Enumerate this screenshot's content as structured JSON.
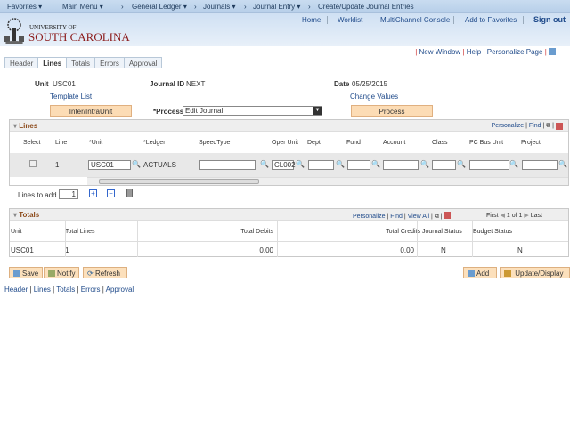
{
  "nav": {
    "favorites": "Favorites ▾",
    "main_menu": "Main Menu ▾",
    "bc1": "General Ledger ▾",
    "bc2": "Journals ▾",
    "bc3": "Journal Entry ▾",
    "bc4": "Create/Update Journal Entries"
  },
  "header": {
    "logo_line1": "UNIVERSITY OF",
    "logo_line2": "SOUTH CAROLINA",
    "links": [
      "Home",
      "Worklist",
      "MultiChannel Console",
      "Add to Favorites",
      "Sign out"
    ]
  },
  "toplinks": {
    "new_window": "New Window",
    "help": "Help",
    "personalize": "Personalize Page"
  },
  "tabs": [
    "Header",
    "Lines",
    "Totals",
    "Errors",
    "Approval"
  ],
  "form": {
    "unit_label": "Unit",
    "unit": "USC01",
    "journal_label": "Journal ID",
    "journal": "NEXT",
    "date_label": "Date",
    "date": "05/25/2015",
    "template_list": "Template List",
    "change_values": "Change Values",
    "inter_btn": "Inter/IntraUnit",
    "process_label": "*Process",
    "process_value": "Edit Journal",
    "process_btn": "Process"
  },
  "lines": {
    "title": "Lines",
    "personalize": "Personalize",
    "find": "Find",
    "headers": [
      "Select",
      "Line",
      "*Unit",
      "*Ledger",
      "SpeedType",
      "Oper Unit",
      "Dept",
      "Fund",
      "Account",
      "Class",
      "PC Bus Unit",
      "Project"
    ],
    "row": {
      "line": "1",
      "unit": "USC01",
      "ledger": "ACTUALS",
      "oper_unit": "CL002"
    },
    "lines_to_add_label": "Lines to add",
    "lines_to_add": "1"
  },
  "totals": {
    "title": "Totals",
    "personalize": "Personalize",
    "find": "Find",
    "view_all": "View All",
    "first": "First",
    "pager": "1 of 1",
    "last": "Last",
    "headers": [
      "Unit",
      "Total Lines",
      "Total Debits",
      "Total Credits",
      "Journal Status",
      "Budget Status"
    ],
    "row": [
      "USC01",
      "1",
      "0.00",
      "0.00",
      "N",
      "N"
    ]
  },
  "buttons": {
    "save": "Save",
    "notify": "Notify",
    "refresh": "Refresh",
    "add": "Add",
    "update": "Update/Display"
  },
  "bottom_links": [
    "Header",
    "Lines",
    "Totals",
    "Errors",
    "Approval"
  ]
}
